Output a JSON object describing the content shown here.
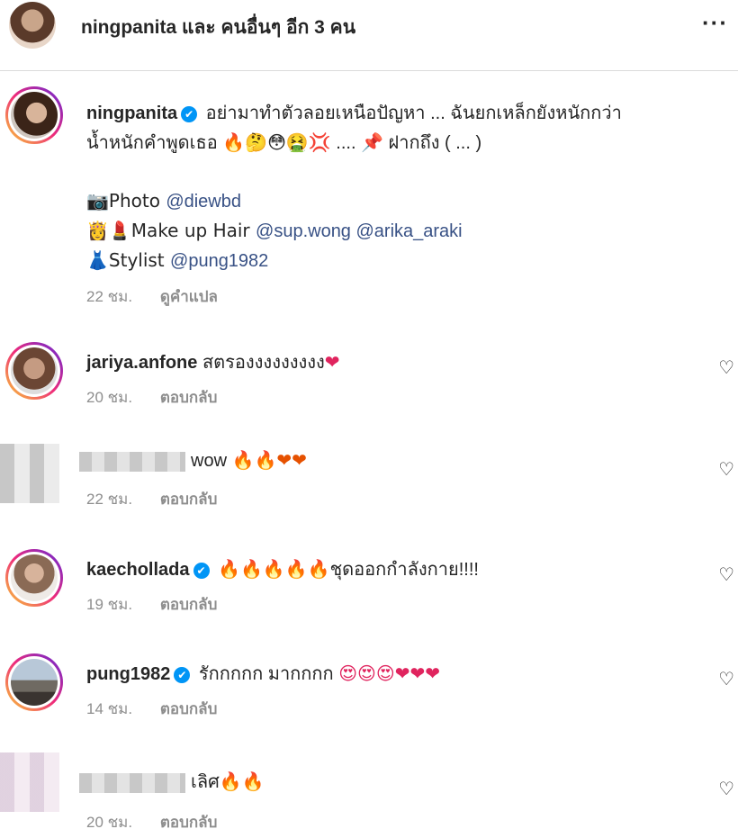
{
  "header": {
    "title": "ningpanita และ คนอื่นๆ อีก 3 คน",
    "more": "···"
  },
  "post": {
    "username": "ningpanita",
    "verified_mark": "✔",
    "caption_line1": "อย่ามาทำตัวลอยเหนือปัญหา ... ฉันยกเหล็กยังหนักกว่า",
    "caption_line2_text": "น้ำหนักคำพูดเธอ",
    "caption_line2_emoji": "🔥🤔😳🤮💢",
    "caption_line2_rest": " .... 📌 ฝากถึง ( ... )",
    "photo_label": "📷Photo ",
    "photo_mention": "@diewbd",
    "makeup_label": "👸💄Make up Hair ",
    "makeup_mentions": "@sup.wong @arika_araki",
    "stylist_label": "👗Stylist ",
    "stylist_mention": "@pung1982",
    "time": "22 ชม.",
    "translate": "ดูคำแปล"
  },
  "comments": [
    {
      "username": "jariya.anfone",
      "text": "สตรองงงงงงงงง",
      "emoji": "❤",
      "time": "20 ชม.",
      "reply": "ตอบกลับ"
    },
    {
      "username": "",
      "text": "wow",
      "emoji": "🔥🔥❤❤",
      "time": "22 ชม.",
      "reply": "ตอบกลับ"
    },
    {
      "username": "kaechollada",
      "emoji": "🔥🔥🔥🔥🔥",
      "text": "ชุดออกกำลังกาย!!!!",
      "time": "19 ชม.",
      "reply": "ตอบกลับ"
    },
    {
      "username": "pung1982",
      "text": "รักกกกก มากกกก",
      "emoji": "😍😍😍❤❤❤",
      "time": "14 ชม.",
      "reply": "ตอบกลับ"
    },
    {
      "username": "",
      "text": "เลิศ",
      "emoji": "🔥🔥",
      "time": "20 ชม.",
      "reply": "ตอบกลับ"
    }
  ],
  "icons": {
    "heart": "♡"
  }
}
